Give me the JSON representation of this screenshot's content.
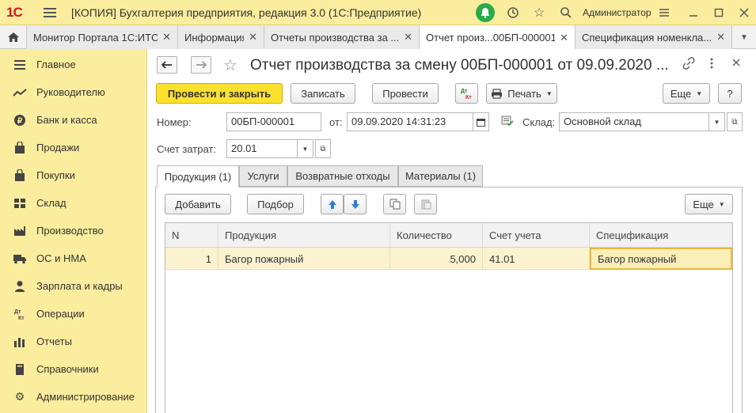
{
  "app": {
    "logo": "1С",
    "title": "[КОПИЯ] Бухгалтерия предприятия, редакция 3.0  (1С:Предприятие)",
    "user": "Администратор"
  },
  "tabs": [
    {
      "label": "Монитор Портала 1С:ИТС",
      "close": "✕"
    },
    {
      "label": "Информация",
      "close": "✕"
    },
    {
      "label": "Отчеты производства за ...",
      "close": "✕"
    },
    {
      "label": "Отчет произ...00БП-000001",
      "close": "✕"
    },
    {
      "label": "Спецификация номенкла...",
      "close": "✕"
    }
  ],
  "sidebar": {
    "items": [
      {
        "label": "Главное",
        "icon": "menu-icon"
      },
      {
        "label": "Руководителю",
        "icon": "trend-icon"
      },
      {
        "label": "Банк и касса",
        "icon": "coin-icon"
      },
      {
        "label": "Продажи",
        "icon": "bag-icon"
      },
      {
        "label": "Покупки",
        "icon": "cart-icon"
      },
      {
        "label": "Склад",
        "icon": "warehouse-icon"
      },
      {
        "label": "Производство",
        "icon": "factory-icon"
      },
      {
        "label": "ОС и НМА",
        "icon": "truck-icon"
      },
      {
        "label": "Зарплата и кадры",
        "icon": "people-icon"
      },
      {
        "label": "Операции",
        "icon": "dt-kt-icon"
      },
      {
        "label": "Отчеты",
        "icon": "bar-chart-icon"
      },
      {
        "label": "Справочники",
        "icon": "book-icon"
      },
      {
        "label": "Администрирование",
        "icon": "gear-icon"
      }
    ]
  },
  "form": {
    "title": "Отчет производства за смену 00БП-000001 от 09.09.2020 ...",
    "buttons": {
      "post_close": "Провести и закрыть",
      "save": "Записать",
      "post": "Провести",
      "dtkt": "Дт Кт",
      "print": "Печать",
      "more": "Еще",
      "help": "?"
    },
    "fields": {
      "number_label": "Номер:",
      "number_value": "00БП-000001",
      "date_label": "от:",
      "date_value": "09.09.2020 14:31:23",
      "warehouse_label": "Склад:",
      "warehouse_value": "Основной склад",
      "cost_account_label": "Счет затрат:",
      "cost_account_value": "20.01"
    },
    "form_tabs": [
      {
        "label": "Продукция (1)"
      },
      {
        "label": "Услуги"
      },
      {
        "label": "Возвратные отходы"
      },
      {
        "label": "Материалы (1)"
      }
    ],
    "table_toolbar": {
      "add": "Добавить",
      "pick": "Подбор",
      "more": "Еще"
    },
    "table": {
      "columns": [
        "N",
        "Продукция",
        "Количество",
        "Счет учета",
        "Спецификация"
      ],
      "rows": [
        {
          "n": "1",
          "product": "Багор пожарный",
          "qty": "5,000",
          "account": "41.01",
          "spec": "Багор пожарный"
        }
      ]
    }
  }
}
